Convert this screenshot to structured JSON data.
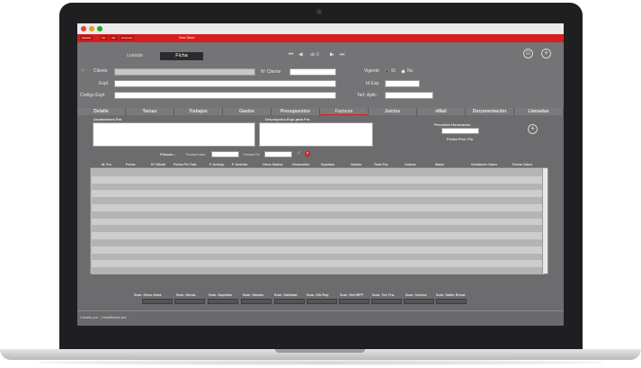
{
  "menubar": {
    "items": [
      "Gestión",
      "Ver",
      "Ver",
      "Acciones"
    ],
    "center_text": "Nos-Save"
  },
  "toolbar": {
    "tabs": [
      {
        "label": "Listado",
        "active": false
      },
      {
        "label": "Ficha",
        "active": true
      }
    ],
    "nav": {
      "first": "⏮",
      "prev": "◀",
      "record": "de 0",
      "next": "▶",
      "last": "⏭"
    },
    "user_icon": "☺",
    "add_icon": "+"
  },
  "form": {
    "cliente_label": "Cliente",
    "n_cliente_label": "Nº Cliente",
    "vigente_label": "Vigente",
    "si_label": "Sí",
    "no_label": "No",
    "expl_label": "Expl.",
    "id_exp_label": "Id Exp.",
    "codigo_expl_label": "Codigo Expl.",
    "tarf_aplic_label": "Tarf. Aplic."
  },
  "section_tabs": [
    {
      "label": "Detalle"
    },
    {
      "label": "Tareas"
    },
    {
      "label": "Trabajos"
    },
    {
      "label": "Gastos"
    },
    {
      "label": "Presupuestos"
    },
    {
      "label": "Facturas"
    },
    {
      "label": "Juicios"
    },
    {
      "label": "eMail"
    },
    {
      "label": "Documentación"
    },
    {
      "label": "Llamadas"
    }
  ],
  "facturas": {
    "anotaciones_label": "Anotaciones Fra",
    "descripcion_label": "Descripcion Expl para Fra",
    "prevision_label": "Previsión Honorarios",
    "fecha_prev_label": "Fecha Prev. Fin",
    "filtrado_label": "Filtrado :",
    "fecha_inicio_label": "Fecha Inicio",
    "fecha_fin_label": "Fecha Fin",
    "columns": [
      "Id. Fra",
      "Fecha",
      "Nº Oficial",
      "Fecha Fin Trab.",
      "F. Anticip.",
      "F. Anterior",
      "Otros Gastos",
      "Honorarios",
      "Suplidos",
      "Gastos",
      "Total Fra.",
      "Cobros",
      "Saldo",
      "Gestiones Cobro",
      "Fecha Cobro"
    ],
    "empty_rows": 15,
    "totals": [
      "Sum. Otros Gast.",
      "Sum. Honor.",
      "Sum. Suplidos",
      "Sum. Gastos",
      "Sum. Subtotal",
      "Sum. IVA Rep",
      "Sum. Ret.IRPF",
      "Sum. Tot. Fra.",
      "Sum. Cobros",
      "Sum. Saldo Resul."
    ]
  },
  "footer": {
    "text": "Creado por ,    |  Modificado por ,"
  },
  "colors": {
    "brand_red": "#d81e1e",
    "panel": "#6e6e70"
  }
}
